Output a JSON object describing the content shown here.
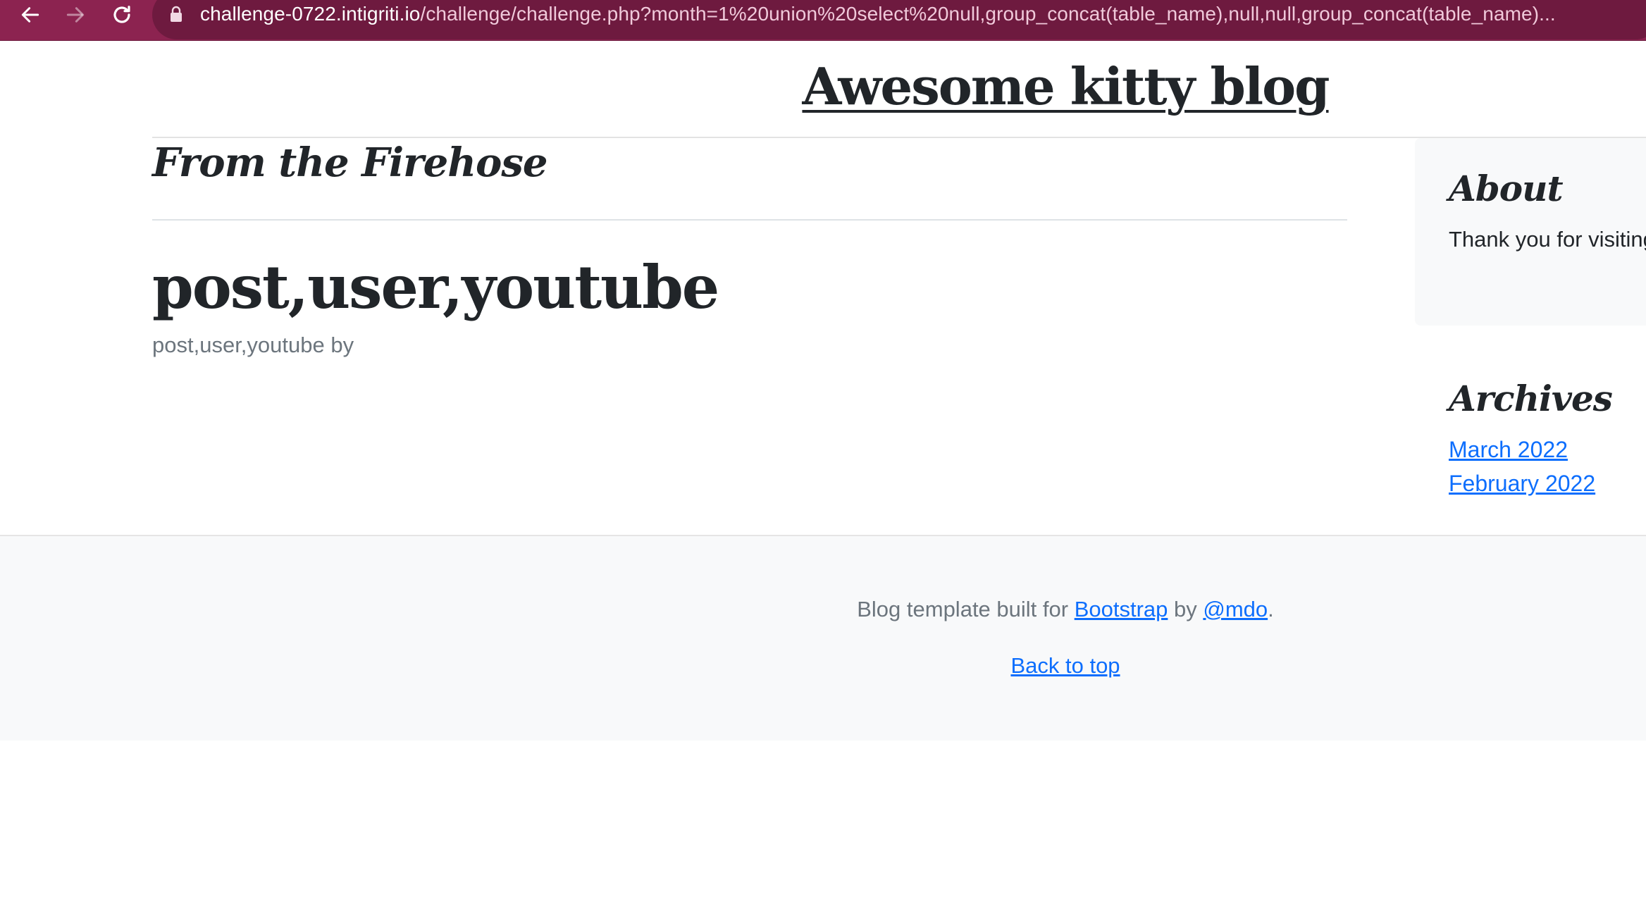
{
  "browser": {
    "url_host": "challenge-0722.intigriti.io",
    "url_path": "/challenge/challenge.php?month=1%20union%20select%20null,group_concat(table_name),null,null,group_concat(table_name)...",
    "back_icon": "arrow-left-icon",
    "forward_icon": "arrow-right-icon",
    "reload_icon": "reload-icon",
    "lock_icon": "lock-icon",
    "chrome_color": "#8c2350"
  },
  "header": {
    "blog_title": "Awesome kitty blog"
  },
  "main": {
    "section_heading": "From the Firehose",
    "post_title": "post,user,youtube",
    "post_meta": "post,user,youtube by"
  },
  "sidebar": {
    "about_title": "About",
    "about_text": "Thank you for visiting. I love kitties",
    "archives_title": "Archives",
    "archives": [
      {
        "label": "March 2022"
      },
      {
        "label": "February 2022"
      }
    ]
  },
  "footer": {
    "credit_prefix": "Blog template built for ",
    "credit_link1": "Bootstrap",
    "credit_mid": " by ",
    "credit_link2": "@mdo",
    "credit_suffix": ".",
    "back_to_top": "Back to top"
  },
  "colors": {
    "link": "#0d6efd",
    "text": "#212529",
    "muted": "#6c757d"
  }
}
